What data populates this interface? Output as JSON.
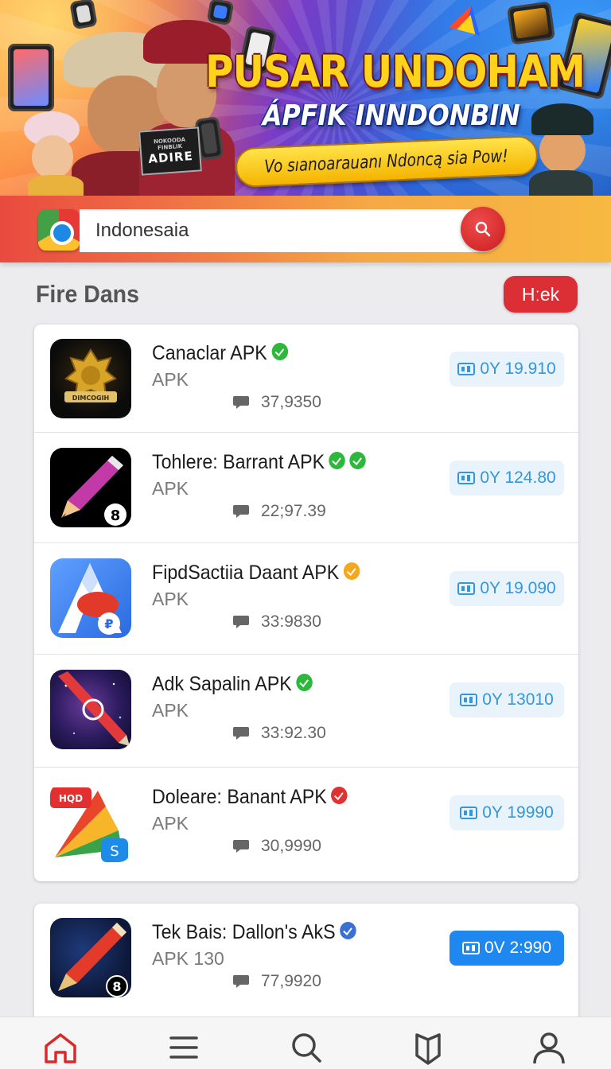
{
  "banner": {
    "title": "PUSAR UNDOHAM",
    "subtitle": "ÁPFIK INNDONBIN",
    "ribbon": "Vo sıanoarauanı Ndoncą sia Pow!",
    "sign_big": "ADIRE",
    "sign_small": "NOKOODA FINBLIK"
  },
  "search": {
    "value": "Indonesaia"
  },
  "section": {
    "title": "Fire Dans",
    "pill_label": "Hːek"
  },
  "apps": [
    {
      "name": "Canaclar APK",
      "type": "APK",
      "count": "37,9350",
      "stat": "0Y 19.910",
      "badges": [
        "#2db83d"
      ],
      "colors": [
        "#0b0b0b",
        "#d8a529"
      ]
    },
    {
      "name": "Tohlere: Barrant APK",
      "type": "APK",
      "count": "22;97.39",
      "stat": "0Y 124.80",
      "badges": [
        "#2db83d",
        "#2db83d"
      ],
      "colors": [
        "#000000",
        "#c23aa8"
      ]
    },
    {
      "name": "FipdSactiia Daant APK",
      "type": "APK",
      "count": "33:9830",
      "stat": "0Y 19.090",
      "badges": [
        "#f4a81d"
      ],
      "colors": [
        "#2a6ae0",
        "#e23a2a"
      ]
    },
    {
      "name": "Adk Sapalin APK",
      "type": "APK",
      "count": "33:92.30",
      "stat": "0Y 13010",
      "badges": [
        "#2db83d"
      ],
      "colors": [
        "#2a1a5c",
        "#e23a3a"
      ]
    },
    {
      "name": "Doleare: Banant APK",
      "type": "APK",
      "count": "30,9990",
      "stat": "0Y 19990",
      "badges": [
        "#e03030"
      ],
      "colors": [
        "#ffffff",
        "#e8452a"
      ]
    },
    {
      "name": "Tek Bais: Dallon's AkS",
      "type": "APK 130",
      "count": "77,9920",
      "stat": "0V 2:990",
      "badges": [
        "#3a6fd8"
      ],
      "colors": [
        "#0d1838",
        "#e33a2a"
      ]
    }
  ],
  "icon_labels": {
    "app1": "DIMCOGIH",
    "app2": "8",
    "app3": "₽",
    "app5_tag": "HQD",
    "app5_s": "S",
    "app6": "8"
  },
  "nav": {
    "items": [
      "home-icon",
      "menu-icon",
      "search-icon",
      "bookmark-icon",
      "profile-icon"
    ],
    "active": "home-icon",
    "accent": "#d82a2a"
  }
}
